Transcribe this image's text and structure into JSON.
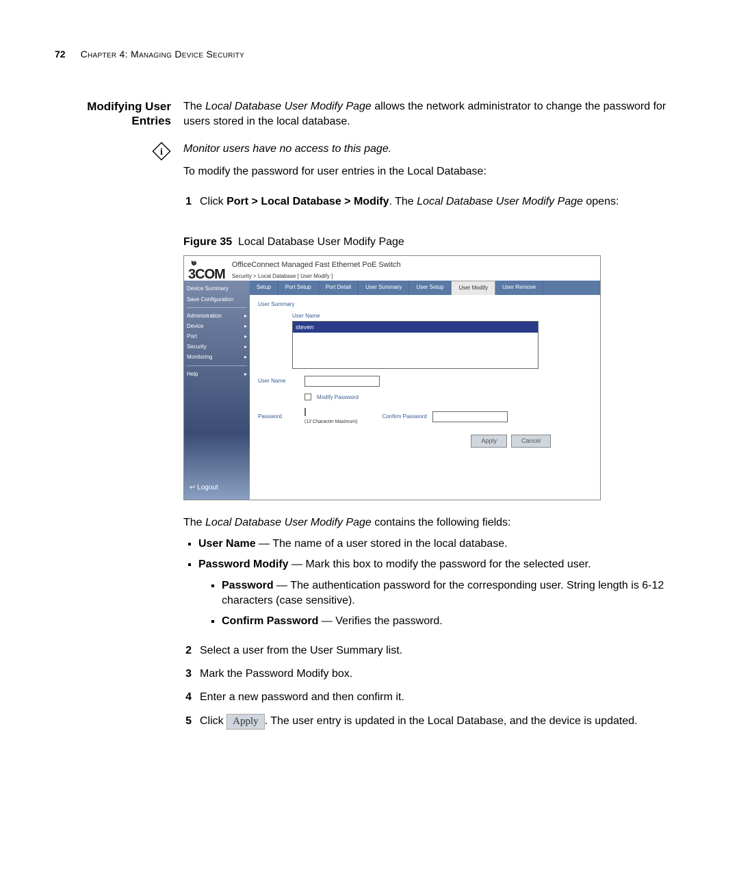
{
  "header": {
    "page_number": "72",
    "chapter": "Chapter 4: Managing Device Security"
  },
  "section_title": "Modifying User Entries",
  "intro": {
    "prefix": "The ",
    "page_name": "Local Database User Modify Page",
    "rest": " allows the network administrator to change the password for users stored in the local database."
  },
  "note": "Monitor users have no access to this page.",
  "lead_in": "To modify the password for user entries in the Local Database:",
  "step1": {
    "num": "1",
    "t1": "Click ",
    "menu": "Port > Local Database > Modify",
    "t2": ". The ",
    "page_name": "Local Database User Modify Page",
    "t3": " opens:"
  },
  "figure": {
    "label": "Figure 35",
    "caption": "Local Database User Modify Page"
  },
  "screenshot": {
    "product_title": "OfficeConnect Managed Fast Ethernet PoE Switch",
    "breadcrumb": "Security > Local Database [ User Modify ]",
    "logo": "3COM",
    "sidebar": {
      "items": [
        "Device Summary",
        "Save Configuration",
        "Administration",
        "Device",
        "Port",
        "Security",
        "Monitoring",
        "Help"
      ],
      "logout": "Logout"
    },
    "tabs": [
      "Setup",
      "Port Setup",
      "Port Detail",
      "User Summary",
      "User Setup",
      "User Modify",
      "User Remove"
    ],
    "panel": {
      "user_summary_label": "User Summary",
      "user_name_col": "User Name",
      "selected_user": "steven",
      "user_name_label": "User Name",
      "modify_password_label": "Modify Password",
      "password_label": "Password",
      "password_hint": "(12 Character Maximum)",
      "confirm_password_label": "Confirm Password",
      "apply": "Apply",
      "cancel": "Cancel"
    }
  },
  "desc_intro": {
    "t1": "The ",
    "page_name": "Local Database User Modify Page",
    "t2": " contains the following fields:"
  },
  "fields": {
    "user_name": {
      "label": "User Name",
      "text": " — The name of a user stored in the local database."
    },
    "password_modify": {
      "label": "Password Modify",
      "text": " — Mark this box to modify the password for the selected user."
    },
    "password": {
      "label": "Password",
      "text": " — The authentication password for the corresponding user. String length is 6-12 characters (case sensitive)."
    },
    "confirm_password": {
      "label": "Confirm Password",
      "text": " — Verifies the password."
    }
  },
  "step2": {
    "num": "2",
    "text": "Select a user from the User Summary list."
  },
  "step3": {
    "num": "3",
    "text": "Mark the Password Modify box."
  },
  "step4": {
    "num": "4",
    "text": "Enter a new password and then confirm it."
  },
  "step5": {
    "num": "5",
    "t1": "Click ",
    "btn": "Apply",
    "t2": ". The user entry is updated in the ",
    "db": "Local Database",
    "t3": ", and the device is updated."
  }
}
